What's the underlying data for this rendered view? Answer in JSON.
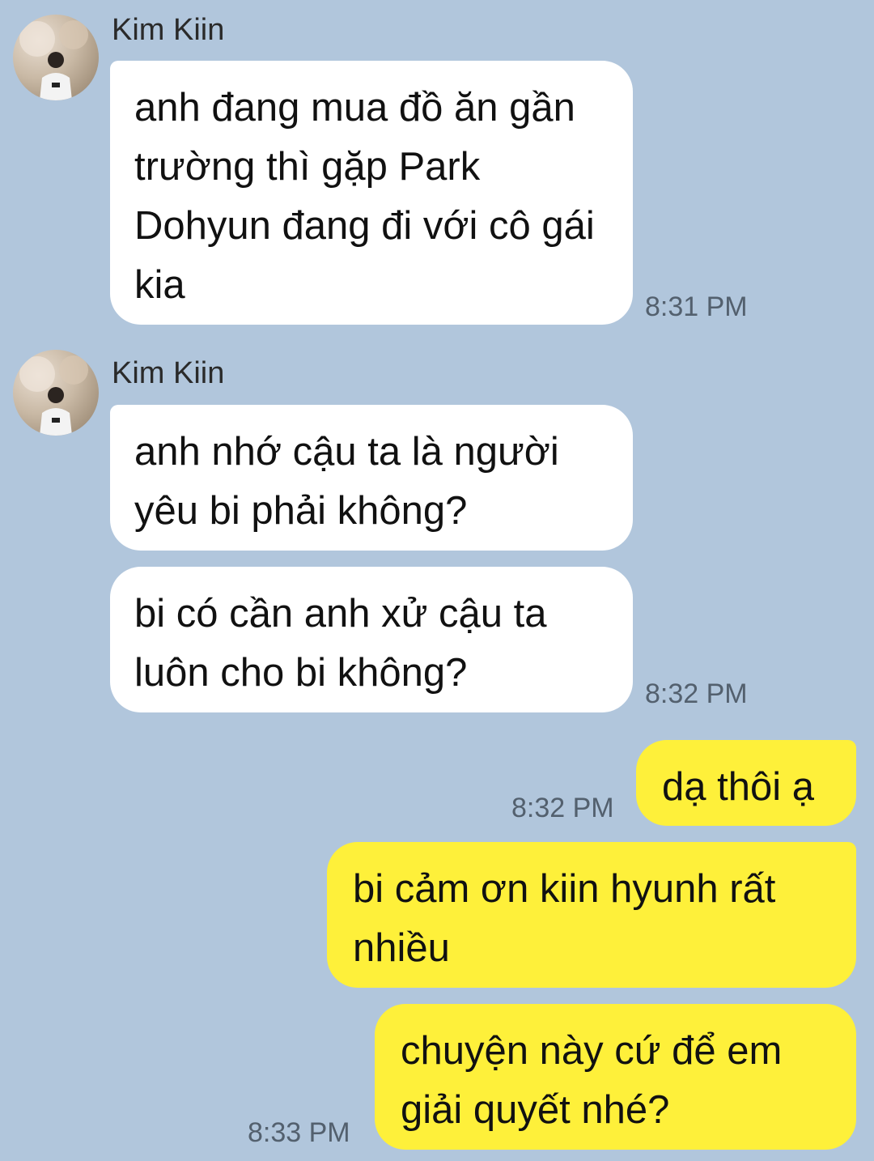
{
  "colors": {
    "background": "#b1c6dc",
    "incoming_bubble": "#ffffff",
    "outgoing_bubble": "#fef03a"
  },
  "groups": [
    {
      "sender": "Kim Kiin"
    },
    {
      "sender": "Kim Kiin"
    }
  ],
  "messages": [
    {
      "text": "anh đang mua đồ ăn gần trường thì gặp Park Dohyun đang đi với cô gái kia"
    },
    {
      "text": "anh nhớ cậu ta là người yêu bi phải không?"
    },
    {
      "text": "bi có cần anh xử cậu ta luôn cho bi không?"
    },
    {
      "text": "dạ thôi ạ"
    },
    {
      "text": "bi cảm ơn kiin hyunh rất nhiều"
    },
    {
      "text": "chuyện này cứ để em giải quyết nhé?"
    }
  ],
  "timestamps": [
    "8:31 PM",
    "8:32 PM",
    "8:32 PM",
    "8:33 PM"
  ]
}
